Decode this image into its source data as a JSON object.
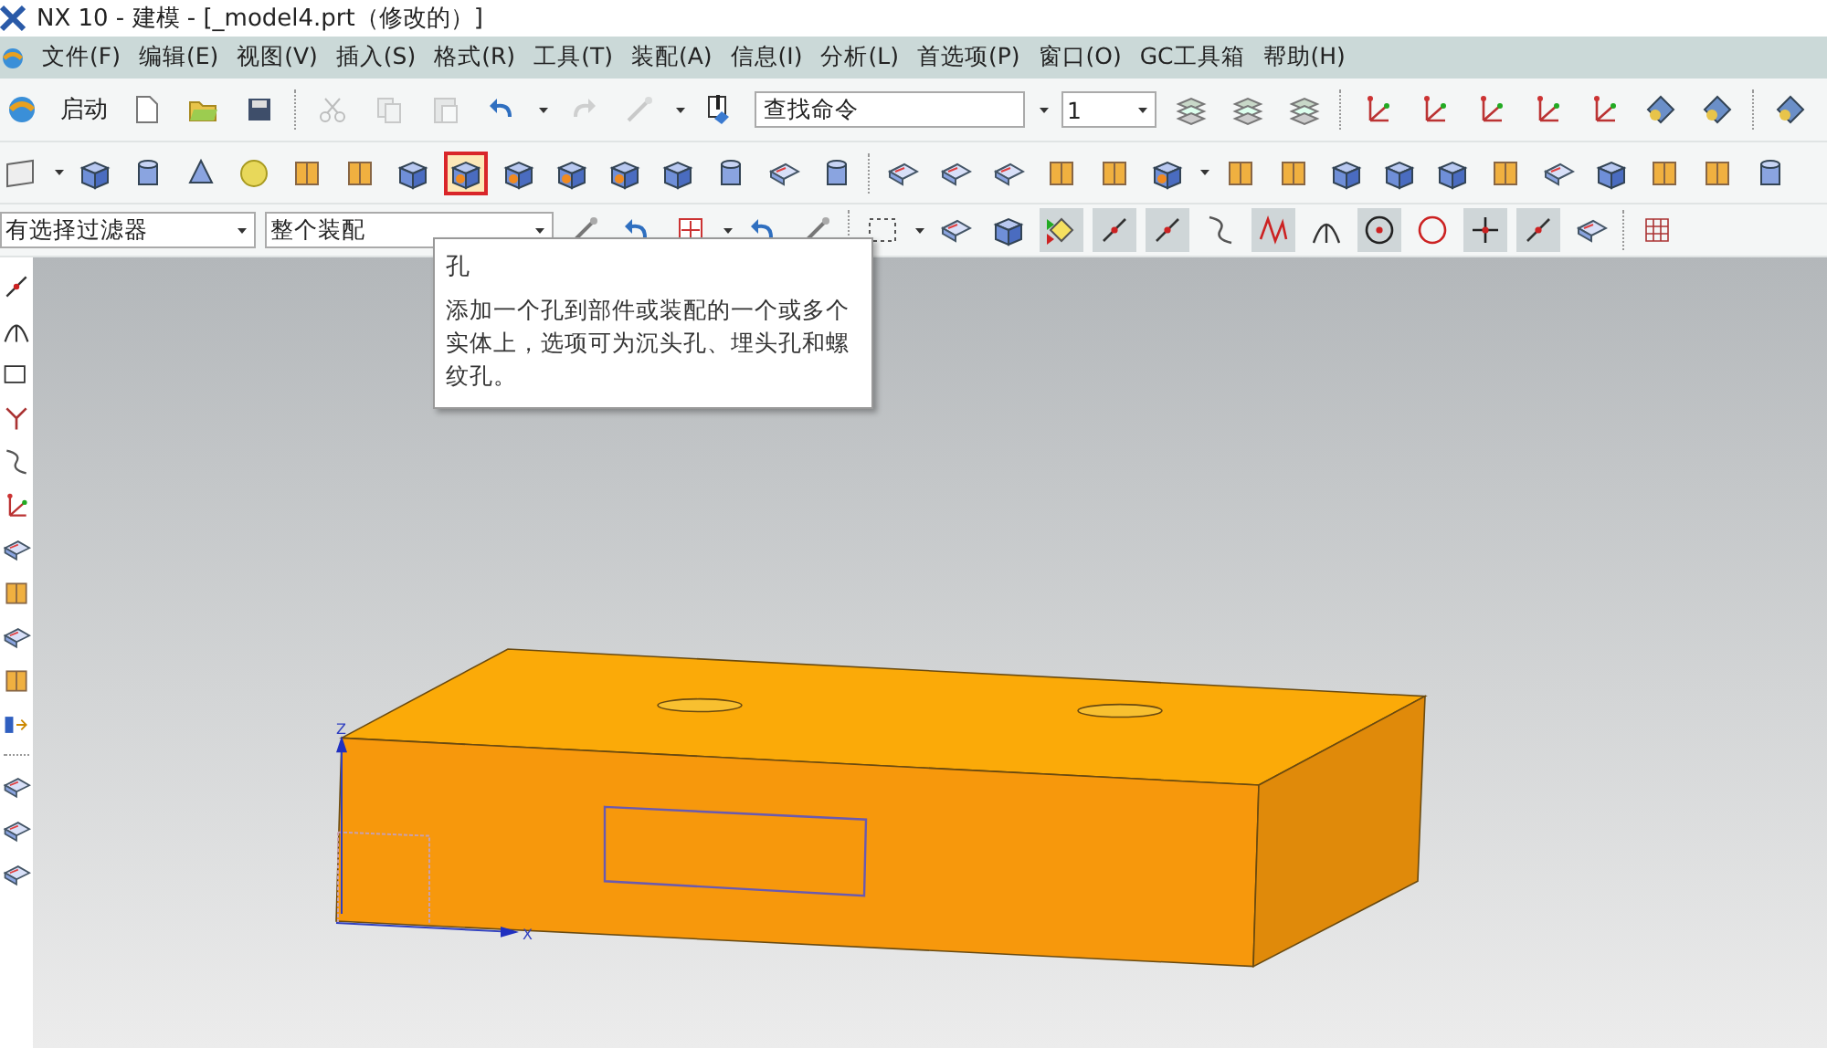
{
  "window": {
    "title": "NX 10 - 建模 - [_model4.prt（修改的）]"
  },
  "menu": [
    "文件(F)",
    "编辑(E)",
    "视图(V)",
    "插入(S)",
    "格式(R)",
    "工具(T)",
    "装配(A)",
    "信息(I)",
    "分析(L)",
    "首选项(P)",
    "窗口(O)",
    "GC工具箱",
    "帮助(H)"
  ],
  "toolbar_1": [
    {
      "kind": "app",
      "disabled": false
    },
    {
      "kind": "button",
      "label": "启动"
    },
    {
      "kind": "page",
      "disabled": false
    },
    {
      "kind": "folder",
      "disabled": false
    },
    {
      "kind": "disk",
      "disabled": false
    },
    {
      "kind": "separator"
    },
    {
      "kind": "scissors",
      "disabled": true
    },
    {
      "kind": "copy",
      "disabled": true
    },
    {
      "kind": "clipboard",
      "disabled": true
    },
    {
      "kind": "undo",
      "disabled": false
    },
    {
      "kind": "caret"
    },
    {
      "kind": "redo",
      "disabled": true
    },
    {
      "kind": "wand",
      "disabled": true
    },
    {
      "kind": "caret"
    },
    {
      "kind": "info",
      "disabled": false
    },
    {
      "kind": "search",
      "placeholder": "查找命令"
    },
    {
      "kind": "caret"
    },
    {
      "kind": "select",
      "value": "1"
    },
    {
      "kind": "layers",
      "disabled": false
    },
    {
      "kind": "layers",
      "disabled": false
    },
    {
      "kind": "layers",
      "disabled": false
    },
    {
      "kind": "separator"
    },
    {
      "kind": "axes",
      "disabled": false
    },
    {
      "kind": "axes",
      "disabled": false
    },
    {
      "kind": "axes",
      "disabled": false
    },
    {
      "kind": "axes",
      "disabled": false
    },
    {
      "kind": "axes",
      "disabled": false
    },
    {
      "kind": "diamond",
      "disabled": false
    },
    {
      "kind": "diamond",
      "disabled": false
    },
    {
      "kind": "separator"
    },
    {
      "kind": "diamond",
      "disabled": false
    }
  ],
  "toolbar_2": [
    {
      "kind": "panel",
      "highlighted": false
    },
    {
      "kind": "caret"
    },
    {
      "kind": "cube",
      "highlighted": false
    },
    {
      "kind": "cylinder",
      "highlighted": false
    },
    {
      "kind": "cone",
      "highlighted": false
    },
    {
      "kind": "sphere",
      "highlighted": false
    },
    {
      "kind": "book",
      "highlighted": false
    },
    {
      "kind": "book",
      "highlighted": false
    },
    {
      "kind": "cube",
      "highlighted": false
    },
    {
      "kind": "hole",
      "highlighted": true
    },
    {
      "kind": "hole",
      "highlighted": false
    },
    {
      "kind": "hole",
      "highlighted": false
    },
    {
      "kind": "hole",
      "highlighted": false
    },
    {
      "kind": "cube",
      "highlighted": false
    },
    {
      "kind": "cylinder",
      "highlighted": false
    },
    {
      "kind": "plate",
      "highlighted": false
    },
    {
      "kind": "cylinder",
      "highlighted": false
    },
    {
      "kind": "separator"
    },
    {
      "kind": "plate",
      "highlighted": false
    },
    {
      "kind": "plate",
      "highlighted": false
    },
    {
      "kind": "plate",
      "highlighted": false
    },
    {
      "kind": "book",
      "highlighted": false
    },
    {
      "kind": "book",
      "highlighted": false
    },
    {
      "kind": "hole",
      "highlighted": false
    },
    {
      "kind": "caret"
    },
    {
      "kind": "book",
      "highlighted": false
    },
    {
      "kind": "book",
      "highlighted": false
    },
    {
      "kind": "cube",
      "highlighted": false
    },
    {
      "kind": "cube",
      "highlighted": false
    },
    {
      "kind": "cube",
      "highlighted": false
    },
    {
      "kind": "book",
      "highlighted": false
    },
    {
      "kind": "plate",
      "highlighted": false
    },
    {
      "kind": "cube",
      "highlighted": false
    },
    {
      "kind": "book",
      "highlighted": false
    },
    {
      "kind": "book",
      "highlighted": false
    },
    {
      "kind": "cylinder",
      "highlighted": false
    }
  ],
  "toolbar_3": [
    {
      "kind": "select",
      "value": "有选择过滤器"
    },
    {
      "kind": "select",
      "value": "整个装配"
    },
    {
      "kind": "wand",
      "on": false
    },
    {
      "kind": "undo",
      "on": false
    },
    {
      "kind": "crosshair",
      "on": false
    },
    {
      "kind": "caret"
    },
    {
      "kind": "undo",
      "on": false
    },
    {
      "kind": "wand",
      "on": false
    },
    {
      "kind": "separator"
    },
    {
      "kind": "dashed",
      "on": false
    },
    {
      "kind": "caret"
    },
    {
      "kind": "plate",
      "on": false
    },
    {
      "kind": "cube",
      "on": false
    },
    {
      "kind": "points",
      "on": true
    },
    {
      "kind": "line",
      "on": true
    },
    {
      "kind": "line",
      "on": true
    },
    {
      "kind": "curve",
      "on": false
    },
    {
      "kind": "zigzag",
      "on": true
    },
    {
      "kind": "arc",
      "on": false
    },
    {
      "kind": "circle",
      "on": true
    },
    {
      "kind": "ring",
      "on": false
    },
    {
      "kind": "plus",
      "on": true
    },
    {
      "kind": "line",
      "on": true
    },
    {
      "kind": "plate",
      "on": false
    },
    {
      "kind": "separator"
    },
    {
      "kind": "grid",
      "on": false
    }
  ],
  "tooltip": {
    "title": "孔",
    "text": "添加一个孔到部件或装配的一个或多个实体上，选项可为沉头孔、埋头孔和螺纹孔。"
  },
  "axis_labels": [
    "Z",
    "X"
  ]
}
